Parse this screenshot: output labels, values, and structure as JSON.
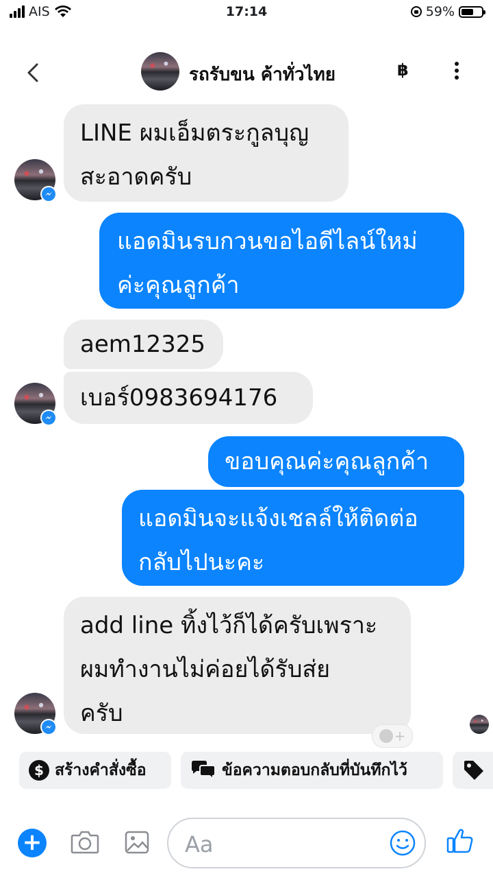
{
  "status_bar": {
    "carrier": "AIS",
    "time": "17:14",
    "battery": "59%",
    "battery_level": 0.59
  },
  "header": {
    "title": "รถรับขน ค้าทั่วไทย",
    "currency_symbol": "฿"
  },
  "messages": [
    {
      "dir": "in",
      "text_lines": [
        "LINE ผมเอ็มตระกูลบุญ",
        "สะอาดครับ"
      ]
    },
    {
      "dir": "out",
      "text_lines": [
        "แอดมินรบกวนขอไอดีไลน์ใหม่",
        "ค่ะคุณลูกค้า"
      ]
    },
    {
      "dir": "in",
      "text_lines": [
        "aem12325"
      ]
    },
    {
      "dir": "in",
      "text_lines": [
        "เบอร์0983694176"
      ]
    },
    {
      "dir": "out",
      "text_lines": [
        "ขอบคุณค่ะคุณลูกค้า"
      ]
    },
    {
      "dir": "out",
      "text_lines": [
        "แอดมินจะแจ้งเชลล์ให้ติดต่อ",
        "กลับไปนะคะ"
      ]
    },
    {
      "dir": "in",
      "text_lines": [
        "add line ทิ้งไว้ก็ได้ครับเพราะ",
        "ผมทำงานไม่ค่อยได้รับส่ย",
        "ครับ"
      ]
    }
  ],
  "quick_replies": [
    {
      "label": "สร้างคำสั่งซื้อ",
      "icon": "dollar-icon"
    },
    {
      "label": "ข้อความตอบกลับที่บันทึกไว้",
      "icon": "chat-bubbles-icon"
    },
    {
      "label": "",
      "icon": "tag-icon"
    }
  ],
  "composer": {
    "placeholder": "Aa"
  },
  "colors": {
    "outgoing_bubble": "#0b84fe",
    "incoming_bubble": "#ececec",
    "accent": "#0b84fe"
  }
}
